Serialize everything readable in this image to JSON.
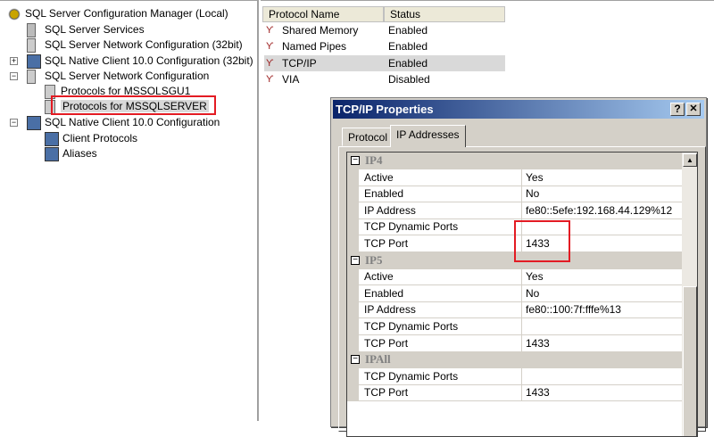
{
  "tree": {
    "root": "SQL Server Configuration Manager (Local)",
    "items": [
      {
        "label": "SQL Server Services"
      },
      {
        "label": "SQL Server Network Configuration (32bit)"
      },
      {
        "label": "SQL Native Client 10.0 Configuration (32bit)",
        "expander": "+"
      },
      {
        "label": "SQL Server Network Configuration",
        "expander": "−"
      },
      {
        "label": "Protocols for MSSOLSGU1"
      },
      {
        "label": "Protocols for MSSQLSERVER"
      },
      {
        "label": "SQL Native Client 10.0 Configuration",
        "expander": "−"
      },
      {
        "label": "Client Protocols"
      },
      {
        "label": "Aliases"
      }
    ]
  },
  "list": {
    "columns": [
      "Protocol Name",
      "Status"
    ],
    "rows": [
      {
        "name": "Shared Memory",
        "status": "Enabled"
      },
      {
        "name": "Named Pipes",
        "status": "Enabled"
      },
      {
        "name": "TCP/IP",
        "status": "Enabled"
      },
      {
        "name": "VIA",
        "status": "Disabled"
      }
    ]
  },
  "dialog": {
    "title": "TCP/IP Properties",
    "help": "?",
    "close": "✕",
    "tabs": [
      "Protocol",
      "IP Addresses"
    ],
    "collapse": "−",
    "groups": [
      {
        "name": "IP4",
        "props": [
          [
            "Active",
            "Yes"
          ],
          [
            "Enabled",
            "No"
          ],
          [
            "IP Address",
            "fe80::5efe:192.168.44.129%12"
          ],
          [
            "TCP Dynamic Ports",
            ""
          ],
          [
            "TCP Port",
            "1433"
          ]
        ]
      },
      {
        "name": "IP5",
        "props": [
          [
            "Active",
            "Yes"
          ],
          [
            "Enabled",
            "No"
          ],
          [
            "IP Address",
            "fe80::100:7f:fffe%13"
          ],
          [
            "TCP Dynamic Ports",
            ""
          ],
          [
            "TCP Port",
            "1433"
          ]
        ]
      },
      {
        "name": "IPAll",
        "props": [
          [
            "TCP Dynamic Ports",
            ""
          ],
          [
            "TCP Port",
            "1433"
          ]
        ]
      }
    ],
    "scroll_up": "▲"
  }
}
